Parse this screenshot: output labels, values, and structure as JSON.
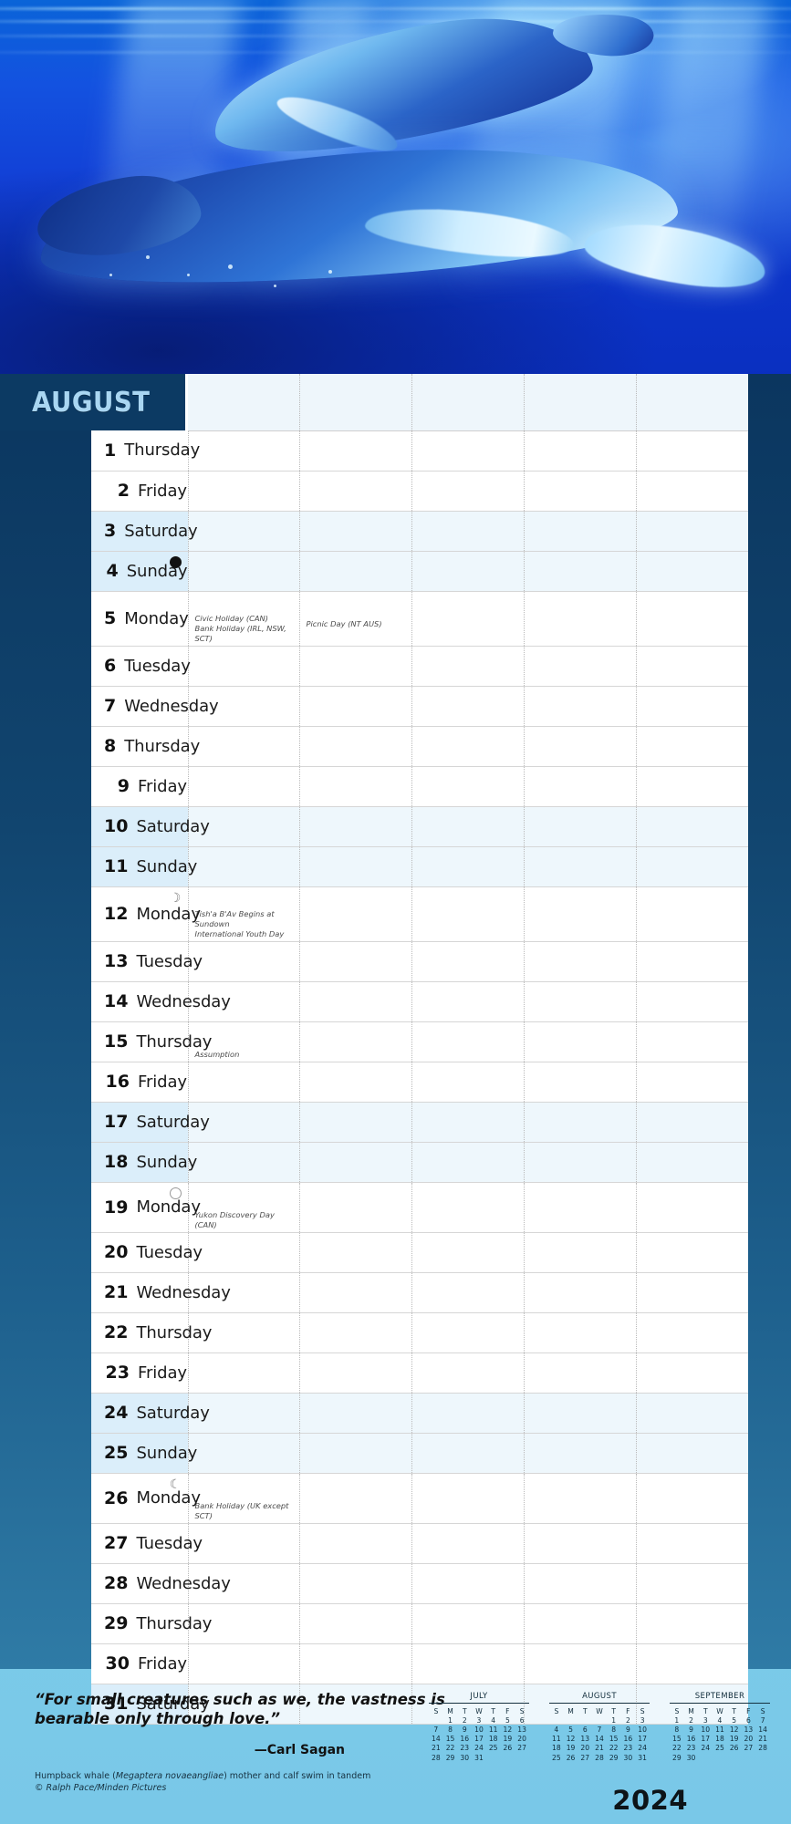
{
  "month": {
    "name": "AUGUST",
    "year": "2024"
  },
  "photo": {
    "alt": "humpback-whale-mother-and-calf-underwater",
    "accent_deep": "#0a3a6b",
    "accent_blue": "#1240d6",
    "accent_light": "#7ecdea"
  },
  "columns": {
    "day": "",
    "notes": "",
    "c2": "",
    "c3": "",
    "c4": "",
    "c5": ""
  },
  "days": [
    {
      "num": "1",
      "name": "Thursday",
      "weekend": false,
      "moon": "",
      "notes": []
    },
    {
      "num": "2",
      "name": "Friday",
      "weekend": false,
      "moon": "",
      "notes": []
    },
    {
      "num": "3",
      "name": "Saturday",
      "weekend": true,
      "moon": "",
      "notes": []
    },
    {
      "num": "4",
      "name": "Sunday",
      "weekend": true,
      "moon": "new",
      "notes": []
    },
    {
      "num": "5",
      "name": "Monday",
      "weekend": false,
      "moon": "",
      "notes": [
        "Civic Holiday (CAN)",
        "Bank Holiday (IRL, NSW, SCT)"
      ],
      "notes2": [
        "Picnic Day (NT AUS)"
      ]
    },
    {
      "num": "6",
      "name": "Tuesday",
      "weekend": false,
      "moon": "",
      "notes": []
    },
    {
      "num": "7",
      "name": "Wednesday",
      "weekend": false,
      "moon": "",
      "notes": []
    },
    {
      "num": "8",
      "name": "Thursday",
      "weekend": false,
      "moon": "",
      "notes": []
    },
    {
      "num": "9",
      "name": "Friday",
      "weekend": false,
      "moon": "",
      "notes": []
    },
    {
      "num": "10",
      "name": "Saturday",
      "weekend": true,
      "moon": "",
      "notes": []
    },
    {
      "num": "11",
      "name": "Sunday",
      "weekend": true,
      "moon": "",
      "notes": []
    },
    {
      "num": "12",
      "name": "Monday",
      "weekend": false,
      "moon": "first",
      "notes": [
        "Tish'a B'Av Begins at Sundown",
        "International Youth Day"
      ]
    },
    {
      "num": "13",
      "name": "Tuesday",
      "weekend": false,
      "moon": "",
      "notes": []
    },
    {
      "num": "14",
      "name": "Wednesday",
      "weekend": false,
      "moon": "",
      "notes": []
    },
    {
      "num": "15",
      "name": "Thursday",
      "weekend": false,
      "moon": "",
      "notes": [
        "Assumption"
      ]
    },
    {
      "num": "16",
      "name": "Friday",
      "weekend": false,
      "moon": "",
      "notes": []
    },
    {
      "num": "17",
      "name": "Saturday",
      "weekend": true,
      "moon": "",
      "notes": []
    },
    {
      "num": "18",
      "name": "Sunday",
      "weekend": true,
      "moon": "",
      "notes": []
    },
    {
      "num": "19",
      "name": "Monday",
      "weekend": false,
      "moon": "full",
      "notes": [
        "Yukon Discovery Day (CAN)"
      ]
    },
    {
      "num": "20",
      "name": "Tuesday",
      "weekend": false,
      "moon": "",
      "notes": []
    },
    {
      "num": "21",
      "name": "Wednesday",
      "weekend": false,
      "moon": "",
      "notes": []
    },
    {
      "num": "22",
      "name": "Thursday",
      "weekend": false,
      "moon": "",
      "notes": []
    },
    {
      "num": "23",
      "name": "Friday",
      "weekend": false,
      "moon": "",
      "notes": []
    },
    {
      "num": "24",
      "name": "Saturday",
      "weekend": true,
      "moon": "",
      "notes": []
    },
    {
      "num": "25",
      "name": "Sunday",
      "weekend": true,
      "moon": "",
      "notes": []
    },
    {
      "num": "26",
      "name": "Monday",
      "weekend": false,
      "moon": "last",
      "notes": [
        "Bank Holiday (UK except SCT)"
      ]
    },
    {
      "num": "27",
      "name": "Tuesday",
      "weekend": false,
      "moon": "",
      "notes": []
    },
    {
      "num": "28",
      "name": "Wednesday",
      "weekend": false,
      "moon": "",
      "notes": []
    },
    {
      "num": "29",
      "name": "Thursday",
      "weekend": false,
      "moon": "",
      "notes": []
    },
    {
      "num": "30",
      "name": "Friday",
      "weekend": false,
      "moon": "",
      "notes": []
    },
    {
      "num": "31",
      "name": "Saturday",
      "weekend": true,
      "moon": "",
      "notes": []
    }
  ],
  "footer": {
    "quote": "“For small creatures such as we, the vastness is bearable only through love.”",
    "attribution": "—Carl Sagan",
    "caption_prefix": "Humpback whale (",
    "caption_species": "Megaptera novaeangliae",
    "caption_suffix": ") mother and calf swim in tandem",
    "credit": "© Ralph Pace/Minden Pictures",
    "year": "2024"
  },
  "mini_calendars": [
    {
      "title": "JULY",
      "weekdays": [
        "S",
        "M",
        "T",
        "W",
        "T",
        "F",
        "S"
      ],
      "weeks": [
        [
          "",
          "1",
          "2",
          "3",
          "4",
          "5",
          "6"
        ],
        [
          "7",
          "8",
          "9",
          "10",
          "11",
          "12",
          "13"
        ],
        [
          "14",
          "15",
          "16",
          "17",
          "18",
          "19",
          "20"
        ],
        [
          "21",
          "22",
          "23",
          "24",
          "25",
          "26",
          "27"
        ],
        [
          "28",
          "29",
          "30",
          "31",
          "",
          "",
          ""
        ]
      ]
    },
    {
      "title": "AUGUST",
      "weekdays": [
        "S",
        "M",
        "T",
        "W",
        "T",
        "F",
        "S"
      ],
      "weeks": [
        [
          "",
          "",
          "",
          "",
          "1",
          "2",
          "3"
        ],
        [
          "4",
          "5",
          "6",
          "7",
          "8",
          "9",
          "10"
        ],
        [
          "11",
          "12",
          "13",
          "14",
          "15",
          "16",
          "17"
        ],
        [
          "18",
          "19",
          "20",
          "21",
          "22",
          "23",
          "24"
        ],
        [
          "25",
          "26",
          "27",
          "28",
          "29",
          "30",
          "31"
        ]
      ]
    },
    {
      "title": "SEPTEMBER",
      "weekdays": [
        "S",
        "M",
        "T",
        "W",
        "T",
        "F",
        "S"
      ],
      "weeks": [
        [
          "1",
          "2",
          "3",
          "4",
          "5",
          "6",
          "7"
        ],
        [
          "8",
          "9",
          "10",
          "11",
          "12",
          "13",
          "14"
        ],
        [
          "15",
          "16",
          "17",
          "18",
          "19",
          "20",
          "21"
        ],
        [
          "22",
          "23",
          "24",
          "25",
          "26",
          "27",
          "28"
        ],
        [
          "29",
          "30",
          "",
          "",
          "",
          "",
          ""
        ]
      ]
    }
  ]
}
